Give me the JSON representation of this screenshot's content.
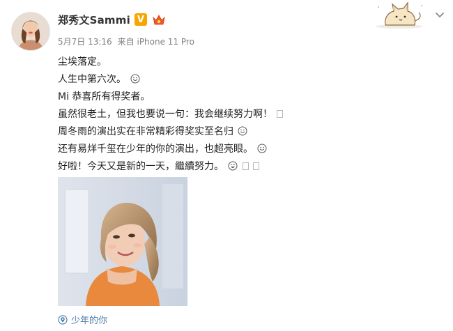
{
  "post": {
    "username": "郑秀文Sammi",
    "verified_mark": "V",
    "date": "5月7日 13:16",
    "source": "来自 iPhone 11 Pro",
    "lines": [
      "尘埃落定。",
      "人生中第六次。",
      "Mi 恭喜所有得奖者。",
      "虽然很老土，但我也要说一句：我会继续努力啊！",
      "周冬雨的演出实在非常精彩得奖实至名归",
      "还有易烊千玺在少年的你的演出，也超亮眼。",
      "好啦！今天又是新的一天，繼續努力。"
    ],
    "location_tag": "少年的你"
  },
  "colors": {
    "username": "#333333",
    "meta_text": "#808080",
    "body_text": "#222222",
    "link": "#507daf",
    "verified_badge": "#f7a600"
  },
  "icons": {
    "verified": "verified-v-badge-icon",
    "crown": "crown-member-icon",
    "corner": "shiba-dog-sticker-icon",
    "menu": "chevron-down-icon",
    "location": "location-pin-icon",
    "smile": "smile-emoji-icon"
  }
}
